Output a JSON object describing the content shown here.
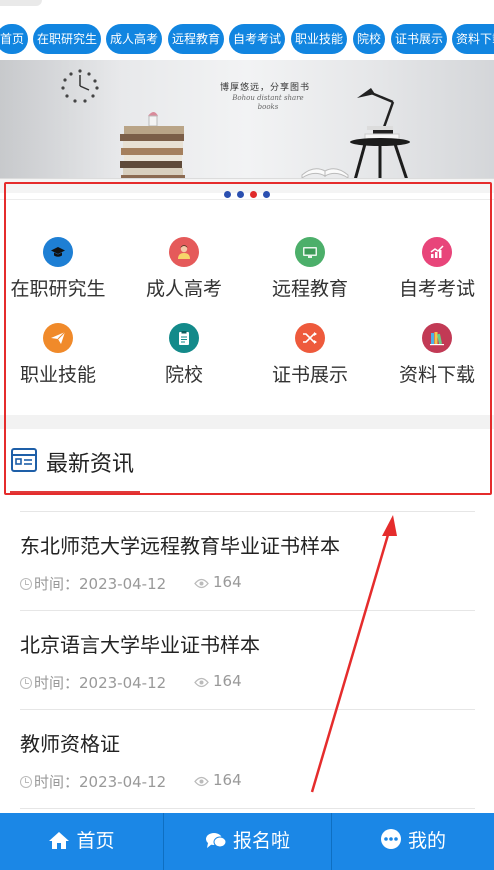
{
  "topnav": {
    "items": [
      "首页",
      "在职研究生",
      "成人高考",
      "远程教育",
      "自考考试",
      "职业技能",
      "院校",
      "证书展示",
      "资料下载"
    ]
  },
  "banner": {
    "tagline": "博厚悠远，分享图书",
    "tagline_en": "Bohou distant share books",
    "slides": 4,
    "active_slide": 3
  },
  "categories": [
    {
      "label": "在职研究生",
      "icon": "graduation-cap-icon",
      "color": "#1e7fd4"
    },
    {
      "label": "成人高考",
      "icon": "person-icon",
      "color": "#e55a5a"
    },
    {
      "label": "远程教育",
      "icon": "monitor-icon",
      "color": "#4caf6a"
    },
    {
      "label": "自考考试",
      "icon": "trend-chart-icon",
      "color": "#e8457a"
    },
    {
      "label": "职业技能",
      "icon": "paper-plane-icon",
      "color": "#f08a2a"
    },
    {
      "label": "院校",
      "icon": "clipboard-icon",
      "color": "#138a8a"
    },
    {
      "label": "证书展示",
      "icon": "shuffle-icon",
      "color": "#ee5a3c"
    },
    {
      "label": "资料下载",
      "icon": "books-icon",
      "color": "#c23a55"
    }
  ],
  "section": {
    "title": "最新资讯"
  },
  "news": [
    {
      "title": "东北师范大学远程教育毕业证书样本",
      "time_label": "时间：2023-04-12",
      "views": "164"
    },
    {
      "title": "北京语言大学毕业证书样本",
      "time_label": "时间：2023-04-12",
      "views": "164"
    },
    {
      "title": "教师资格证",
      "time_label": "时间：2023-04-12",
      "views": "164"
    }
  ],
  "tabbar": {
    "home": "首页",
    "signup": "报名啦",
    "mine": "我的"
  },
  "colors": {
    "primary": "#1b87e6",
    "annotation": "#e52c2c"
  }
}
